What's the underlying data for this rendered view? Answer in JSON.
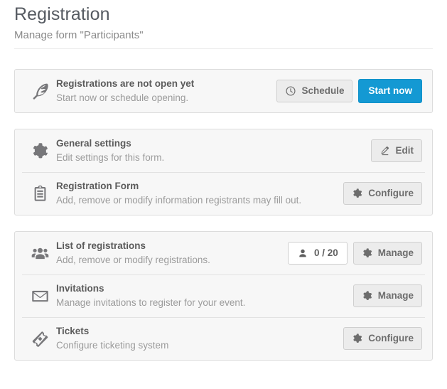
{
  "header": {
    "title": "Registration",
    "subtitle": "Manage form \"Participants\""
  },
  "cards": [
    {
      "id": "status-card",
      "rows": [
        {
          "id": "registration-status",
          "icon": "feather-icon",
          "title": "Registrations are not open yet",
          "desc": "Start now or schedule opening.",
          "actions": [
            {
              "id": "schedule-button",
              "label": "Schedule",
              "icon": "clock-icon",
              "style": "default"
            },
            {
              "id": "start-now-button",
              "label": "Start now",
              "icon": "none",
              "style": "primary"
            }
          ]
        }
      ]
    },
    {
      "id": "settings-card",
      "rows": [
        {
          "id": "general-settings",
          "icon": "gear-icon",
          "title": "General settings",
          "desc": "Edit settings for this form.",
          "actions": [
            {
              "id": "edit-button",
              "label": "Edit",
              "icon": "pencil-icon",
              "style": "default"
            }
          ]
        },
        {
          "id": "registration-form",
          "icon": "clipboard-icon",
          "title": "Registration Form",
          "desc": "Add, remove or modify information registrants may fill out.",
          "actions": [
            {
              "id": "configure-form-button",
              "label": "Configure",
              "icon": "gear-icon",
              "style": "default"
            }
          ]
        }
      ]
    },
    {
      "id": "registrations-card",
      "rows": [
        {
          "id": "list-of-registrations",
          "icon": "people-icon",
          "title": "List of registrations",
          "desc": "Add, remove or modify registrations.",
          "actions": [
            {
              "id": "registration-count-badge",
              "label": "0 / 20",
              "icon": "person-icon",
              "style": "badge"
            },
            {
              "id": "manage-registrations-button",
              "label": "Manage",
              "icon": "gear-icon",
              "style": "default"
            }
          ]
        },
        {
          "id": "invitations",
          "icon": "envelope-icon",
          "title": "Invitations",
          "desc": "Manage invitations to register for your event.",
          "actions": [
            {
              "id": "manage-invitations-button",
              "label": "Manage",
              "icon": "gear-icon",
              "style": "default"
            }
          ]
        },
        {
          "id": "tickets",
          "icon": "ticket-icon",
          "title": "Tickets",
          "desc": "Configure ticketing system",
          "actions": [
            {
              "id": "configure-tickets-button",
              "label": "Configure",
              "icon": "gear-icon",
              "style": "default"
            }
          ]
        }
      ]
    }
  ],
  "colors": {
    "primary": "#1499d3",
    "card_bg": "#f7f7f7",
    "card_border": "#dcdcdc",
    "title_text": "#5b5b5b",
    "desc_text": "#9b9b9b",
    "icon": "#77777a"
  }
}
